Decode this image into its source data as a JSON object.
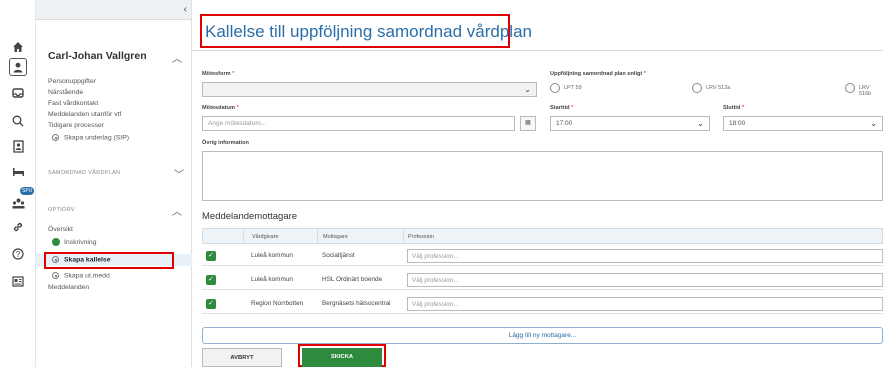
{
  "sidebar": {
    "person_name": "Carl-Johan Vallgren",
    "person_items": [
      "Personuppgifter",
      "Närstående",
      "Fast vårdkontakt",
      "Meddelanden utanför vtf",
      "Tidigare processer"
    ],
    "skapa_underlag": "Skapa underlag (SIP)",
    "section_samordnad": "SAMORDNAD VÅRDPLAN",
    "section_optiorv": "OPTIÖRV",
    "optiorv_items": {
      "oversikt": "Översikt",
      "inskrivning": "Inskrivning",
      "skapa_kallelse": "Skapa kallelse",
      "skapa_ut_medd": "Skapa ut.medd",
      "meddelanden": "Meddelanden"
    }
  },
  "rail": {
    "badge": "SPU"
  },
  "main": {
    "title": "Kallelse till uppföljning samordnad vårdplan",
    "motesform_label": "Mötesform",
    "uppfoljning_label": "Uppföljning samordnad plan enligt",
    "radio_options": [
      "LPT 59",
      "LRV 512a",
      "LRV 516b"
    ],
    "motesdatum_label": "Mötesdatum",
    "motesdatum_placeholder": "Ange mötesdatum...",
    "starttid_label": "Starttid",
    "starttid_value": "17:00",
    "sluttid_label": "Sluttid",
    "sluttid_value": "18:00",
    "ovrig_label": "Övrig information",
    "required_mark": "*",
    "recipients_title": "Meddelandemottagare",
    "columns": [
      "Vårdgivare",
      "Mottagare",
      "Profession"
    ],
    "rows": [
      {
        "vardgivare": "Luleå kommun",
        "mottagare": "Socialtjänst",
        "profession": "Välj profession..."
      },
      {
        "vardgivare": "Luleå kommun",
        "mottagare": "HSL Ordinärt boende",
        "profession": "Välj profession..."
      },
      {
        "vardgivare": "Region Norrbotten",
        "mottagare": "Bergnäsets hälsocentral",
        "profession": "Välj profession..."
      }
    ],
    "add_recipient": "Lägg till ny mottagare...",
    "cancel": "AVBRYT",
    "send": "SKICKA"
  },
  "colors": {
    "accent": "#2a6ea8",
    "success": "#2e8b3e",
    "highlight": "#e00000"
  }
}
